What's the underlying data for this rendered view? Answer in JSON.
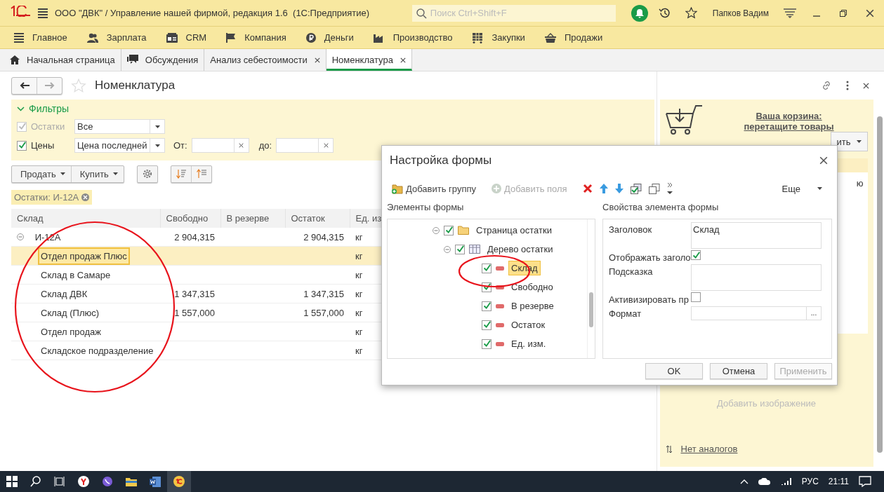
{
  "window": {
    "title": "ООО \"ДВК\" / Управление нашей фирмой, редакция 1.6  (1С:Предприятие)",
    "search_placeholder": "Поиск Ctrl+Shift+F",
    "user": "Папков Вадим"
  },
  "sections": [
    {
      "label": "Главное"
    },
    {
      "label": "Зарплата"
    },
    {
      "label": "CRM"
    },
    {
      "label": "Компания"
    },
    {
      "label": "Деньги"
    },
    {
      "label": "Производство"
    },
    {
      "label": "Закупки"
    },
    {
      "label": "Продажи"
    }
  ],
  "tabs": [
    {
      "label": "Начальная страница",
      "closable": false,
      "selected": false
    },
    {
      "label": "Обсуждения",
      "closable": false,
      "selected": false
    },
    {
      "label": "Анализ себестоимости",
      "closable": true,
      "selected": false
    },
    {
      "label": "Номенклатура",
      "closable": true,
      "selected": true
    }
  ],
  "form": {
    "title": "Номенклатура",
    "filters": {
      "title": "Фильтры",
      "expanded": true,
      "stock": {
        "label": "Остатки",
        "checked": true,
        "disabled": true,
        "value": "Все"
      },
      "prices": {
        "label": "Цены",
        "checked": true,
        "disabled": false,
        "value": "Цена последней",
        "from_label": "От:",
        "to_label": "до:"
      }
    },
    "buttons": [
      "Продать",
      "Купить"
    ],
    "active_filter": "Остатки: И-12А",
    "table": {
      "columns": [
        "Склад",
        "Свободно",
        "В резерве",
        "Остаток",
        "Ед. из"
      ],
      "rows": [
        {
          "name": "И-12А",
          "free": "2 904,315",
          "stock": "2 904,315",
          "unit": "кг",
          "expanded": true,
          "selected": false,
          "children": [
            {
              "name": "Отдел продаж Плюс",
              "unit": "кг",
              "selected": true
            },
            {
              "name": "Склад в Самаре",
              "unit": "кг",
              "selected": false
            },
            {
              "name": "Склад ДВК",
              "free": "1 347,315",
              "stock": "1 347,315",
              "unit": "кг",
              "selected": false
            },
            {
              "name": "Склад (Плюс)",
              "free": "1 557,000",
              "stock": "1 557,000",
              "unit": "кг",
              "selected": false
            },
            {
              "name": "Отдел продаж",
              "unit": "кг",
              "selected": false
            },
            {
              "name": "Складское подразделение",
              "unit": "кг",
              "selected": false
            }
          ]
        }
      ]
    }
  },
  "side_panel": {
    "cart_title": "Ваша корзина:",
    "cart_hint": "перетащите товары",
    "button_fragment": "ить",
    "text_fragment": "ю",
    "add_image": "Добавить изображение",
    "analogs": "Нет аналогов"
  },
  "dialog": {
    "title": "Настройка формы",
    "toolbar": [
      {
        "label": "Добавить группу",
        "disabled": false
      },
      {
        "label": "Добавить поля",
        "disabled": true
      }
    ],
    "more": "Еще",
    "elements_title": "Элементы формы",
    "properties_title": "Свойства элемента формы",
    "tree": [
      {
        "label": "Страница остатки",
        "kind": "folder",
        "checked": true,
        "expanded": true,
        "selected": false,
        "children": [
          {
            "label": "Дерево остатки",
            "kind": "table",
            "checked": true,
            "expanded": true,
            "selected": false,
            "children": [
              {
                "label": "Склад",
                "kind": "field",
                "checked": true,
                "selected": true
              },
              {
                "label": "Свободно",
                "kind": "field",
                "checked": true,
                "selected": false
              },
              {
                "label": "В резерве",
                "kind": "field",
                "checked": true,
                "selected": false
              },
              {
                "label": "Остаток",
                "kind": "field",
                "checked": true,
                "selected": false
              },
              {
                "label": "Ед. изм.",
                "kind": "field",
                "checked": true,
                "selected": false
              }
            ]
          }
        ]
      }
    ],
    "properties": [
      {
        "kind": "textarea",
        "label": "Заголовок",
        "value": "Склад"
      },
      {
        "kind": "checkbox",
        "label": "Отображать заголо",
        "checked": true
      },
      {
        "kind": "textarea",
        "label": "Подсказка"
      },
      {
        "kind": "checkbox",
        "label": "Активизировать пр",
        "checked": false
      },
      {
        "kind": "select",
        "label": "Формат",
        "button": "..."
      }
    ],
    "buttons": [
      {
        "label": "OK",
        "disabled": false
      },
      {
        "label": "Отмена",
        "disabled": false
      },
      {
        "label": "Применить",
        "disabled": true
      }
    ]
  },
  "taskbar": {
    "language": "РУС",
    "time": "21:11"
  }
}
